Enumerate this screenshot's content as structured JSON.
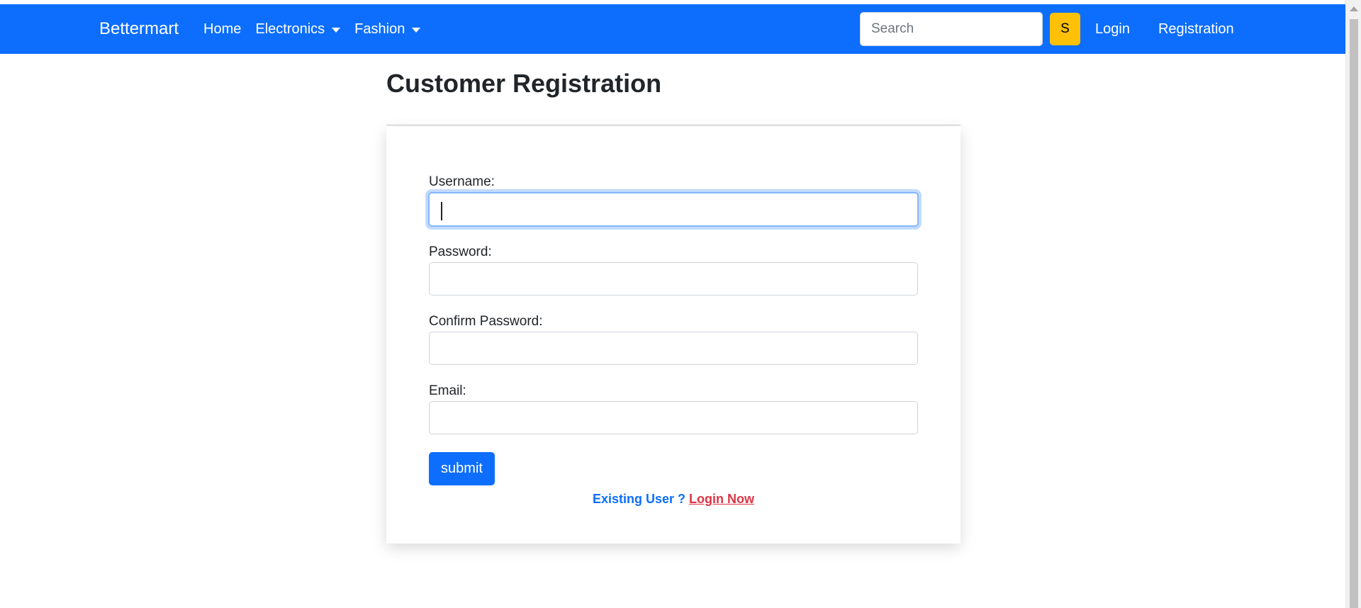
{
  "navbar": {
    "brand": "Bettermart",
    "links": [
      {
        "label": "Home"
      },
      {
        "label": "Electronics"
      },
      {
        "label": "Fashion"
      }
    ],
    "search": {
      "placeholder": "Search",
      "value": "",
      "button_label": "S"
    },
    "auth": {
      "login_label": "Login",
      "registration_label": "Registration"
    }
  },
  "page": {
    "title": "Customer Registration"
  },
  "form": {
    "username_label": "Username:",
    "username_value": "",
    "password_label": "Password:",
    "password_value": "",
    "confirm_password_label": "Confirm Password:",
    "confirm_password_value": "",
    "email_label": "Email:",
    "email_value": "",
    "submit_label": "submit",
    "existing_user_text": "Existing User ?",
    "login_now_label": "Login Now"
  },
  "colors": {
    "navbar_bg": "#0d6efd",
    "search_button_bg": "#ffc107",
    "submit_bg": "#0d6efd",
    "existing_user_text": "#0d6efd",
    "login_now_link": "#dc3545"
  },
  "icons": {
    "electronics_dropdown": "caret-down-icon",
    "fashion_dropdown": "caret-down-icon",
    "scroll_up": "scroll-up-arrow-icon"
  }
}
